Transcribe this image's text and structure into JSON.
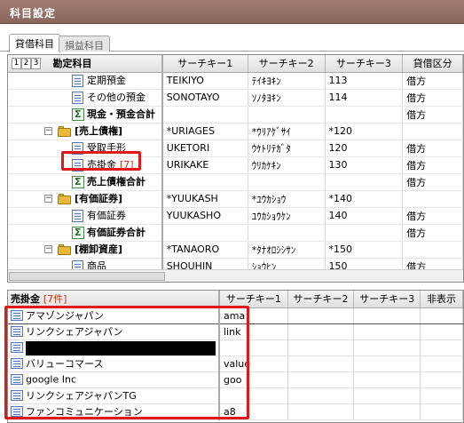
{
  "window": {
    "title": "科目設定"
  },
  "tabs": [
    {
      "label": "貸借科目",
      "active": true
    },
    {
      "label": "損益科目",
      "active": false
    }
  ],
  "top_grid": {
    "level_buttons": [
      "1",
      "2",
      "3"
    ],
    "headers": [
      "勘定科目",
      "サーチキー1",
      "サーチキー2",
      "サーチキー3",
      "貸借区分"
    ],
    "rows": [
      {
        "kind": "doc",
        "indent": 2,
        "label": "定期預金",
        "bold": false,
        "k1": "TEIKIYO",
        "k2": "ﾃｲｷﾖｷﾝ",
        "k3": "113",
        "div": "借方"
      },
      {
        "kind": "doc",
        "indent": 2,
        "label": "その他の預金",
        "bold": false,
        "k1": "SONOTAYO",
        "k2": "ｿﾉﾀﾖｷﾝ",
        "k3": "114",
        "div": "借方"
      },
      {
        "kind": "sum",
        "indent": 2,
        "label": "現金・預金合計",
        "bold": true,
        "k1": "",
        "k2": "",
        "k3": "",
        "div": "借方"
      },
      {
        "kind": "folder",
        "indent": 1,
        "label": "[売上債権]",
        "bold": true,
        "k1": "*URIAGES",
        "k2": "*ｳﾘｱｹﾞｻｲ",
        "k3": "*120",
        "div": "",
        "expander": "−"
      },
      {
        "kind": "doc",
        "indent": 2,
        "label": "受取手形",
        "bold": false,
        "k1": "UKETORI",
        "k2": "ｳｹﾄﾘﾃｶﾞﾀ",
        "k3": "120",
        "div": "借方"
      },
      {
        "kind": "doc",
        "indent": 2,
        "label": "売掛金",
        "count": "[7]",
        "bold": false,
        "k1": "URIKAKE",
        "k2": "ｳﾘｶｹｷﾝ",
        "k3": "130",
        "div": "借方"
      },
      {
        "kind": "sum",
        "indent": 2,
        "label": "売上債権合計",
        "bold": true,
        "k1": "",
        "k2": "",
        "k3": "",
        "div": "借方"
      },
      {
        "kind": "folder",
        "indent": 1,
        "label": "[有価証券]",
        "bold": true,
        "k1": "*YUUKASH",
        "k2": "*ﾕｳｶｼｮｳ",
        "k3": "*140",
        "div": "",
        "expander": "−"
      },
      {
        "kind": "doc",
        "indent": 2,
        "label": "有価証券",
        "bold": false,
        "k1": "YUUKASHO",
        "k2": "ﾕｳｶｼｮｳｹﾝ",
        "k3": "140",
        "div": "借方"
      },
      {
        "kind": "sum",
        "indent": 2,
        "label": "有価証券合計",
        "bold": true,
        "k1": "",
        "k2": "",
        "k3": "",
        "div": "借方"
      },
      {
        "kind": "folder",
        "indent": 1,
        "label": "[棚卸資産]",
        "bold": true,
        "k1": "*TANAORO",
        "k2": "*ﾀﾅｵﾛｼｼｻﾝ",
        "k3": "*150",
        "div": "",
        "expander": "−"
      },
      {
        "kind": "doc",
        "indent": 2,
        "label": "商品",
        "bold": false,
        "k1": "SHOUHIN",
        "k2": "ｼｮｳﾋﾝ",
        "k3": "150",
        "div": "借方"
      }
    ]
  },
  "bottom_grid": {
    "title": "売掛金",
    "count": "[7件]",
    "headers": [
      "サーチキー1",
      "サーチキー2",
      "サーチキー3",
      "非表示"
    ],
    "rows": [
      {
        "name": "アマゾンジャパン",
        "k1": "ama",
        "redacted": false,
        "selected": true
      },
      {
        "name": "リンクシェアジャパン",
        "k1": "link",
        "redacted": false
      },
      {
        "name": "",
        "k1": "",
        "redacted": true
      },
      {
        "name": "バリューコマース",
        "k1": "value",
        "redacted": false
      },
      {
        "name": "google Inc",
        "k1": "goo",
        "redacted": false
      },
      {
        "name": "リンクシェアジャパンTG",
        "k1": "",
        "redacted": false
      },
      {
        "name": "ファンコミュニケーション",
        "k1": "a8",
        "redacted": false
      }
    ]
  },
  "colors": {
    "titlebar": "#8a665c",
    "highlight": "#e01818",
    "count_text": "#cc3311"
  }
}
